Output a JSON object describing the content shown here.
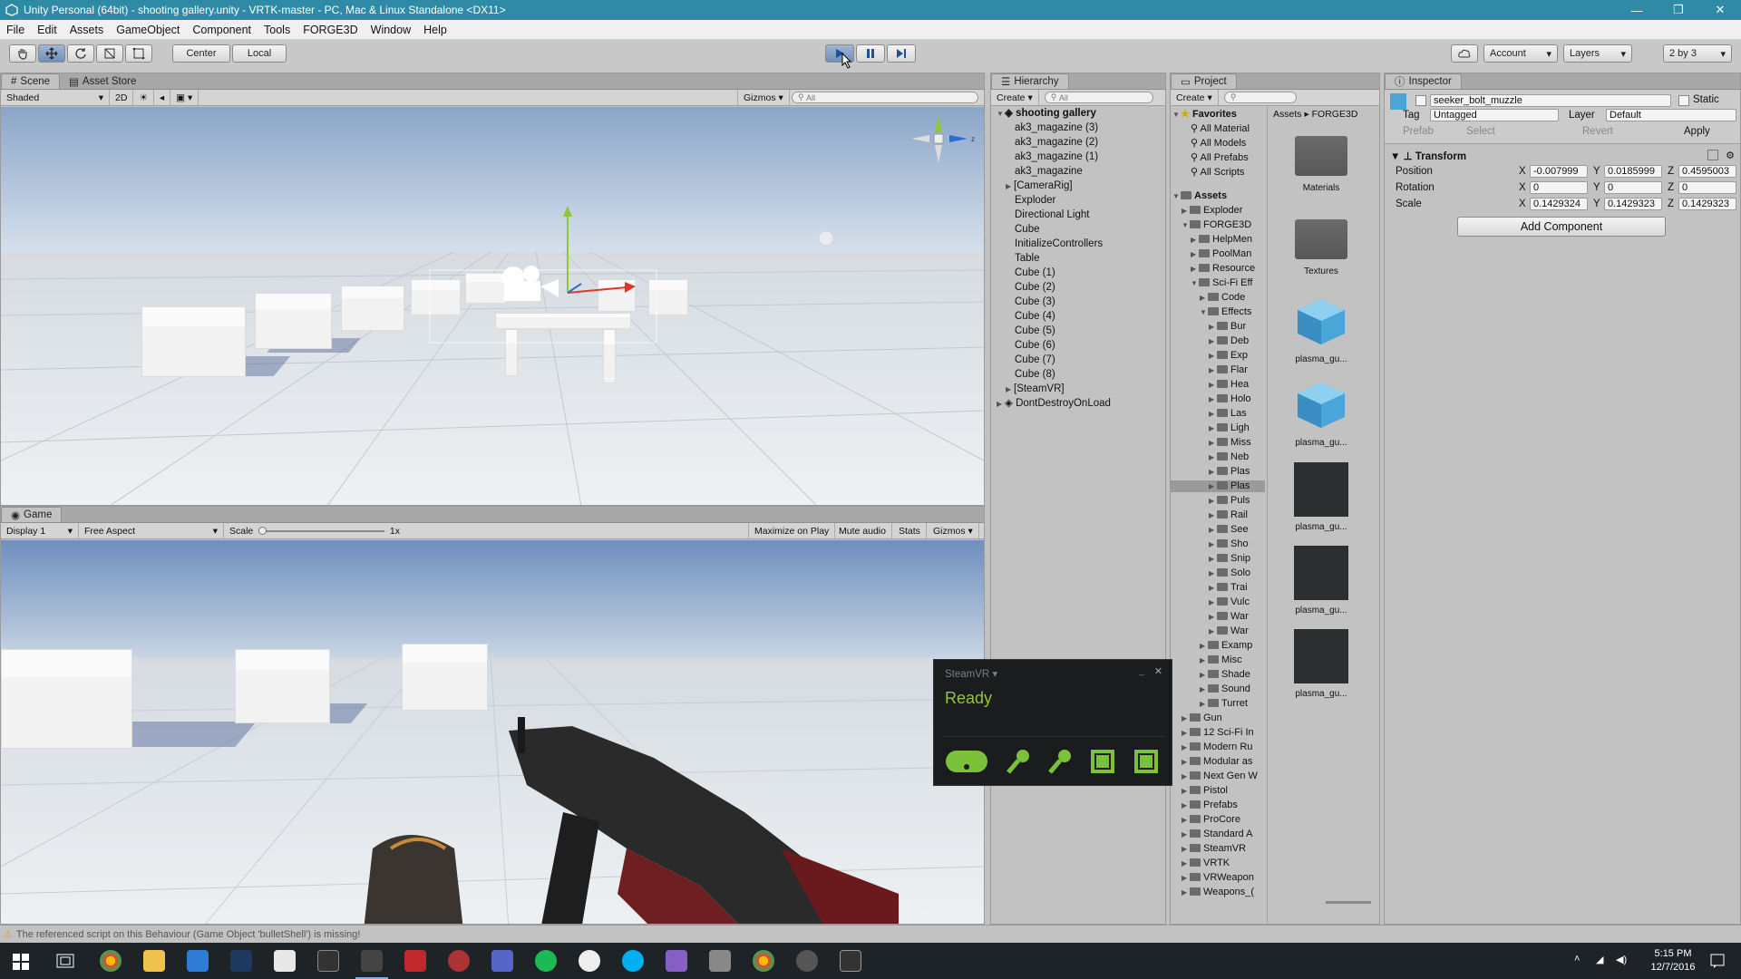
{
  "window": {
    "title": "Unity Personal (64bit) - shooting gallery.unity - VRTK-master - PC, Mac & Linux Standalone <DX11>",
    "controls": [
      "—",
      "❐",
      "✕"
    ]
  },
  "menu": [
    "File",
    "Edit",
    "Assets",
    "GameObject",
    "Component",
    "Tools",
    "FORGE3D",
    "Window",
    "Help"
  ],
  "toolbar": {
    "pivot": "Center",
    "space": "Local",
    "account": "Account",
    "layers": "Layers",
    "layout": "2 by 3"
  },
  "scene": {
    "tabs": [
      "Scene",
      "Asset Store"
    ],
    "shading": "Shaded",
    "mode2d": "2D",
    "gizmos": "Gizmos",
    "search": "All"
  },
  "game": {
    "tab": "Game",
    "display": "Display 1",
    "aspect": "Free Aspect",
    "scale_label": "Scale",
    "scale_value": "1x",
    "maximize": "Maximize on Play",
    "mute": "Mute audio",
    "stats": "Stats",
    "gizmos": "Gizmos"
  },
  "hierarchy": {
    "tab": "Hierarchy",
    "create": "Create",
    "search": "All",
    "scene": "shooting gallery",
    "items": [
      "ak3_magazine (3)",
      "ak3_magazine (2)",
      "ak3_magazine (1)",
      "ak3_magazine",
      "[CameraRig]",
      "Exploder",
      "Directional Light",
      "Cube",
      "InitializeControllers",
      "Table",
      "Cube (1)",
      "Cube (2)",
      "Cube (3)",
      "Cube (4)",
      "Cube (5)",
      "Cube (6)",
      "Cube (7)",
      "Cube (8)",
      "[SteamVR]"
    ],
    "dontdestroy": "DontDestroyOnLoad"
  },
  "project": {
    "tab": "Project",
    "create": "Create",
    "favorites": "Favorites",
    "fav_items": [
      "All Material",
      "All Models",
      "All Prefabs",
      "All Scripts"
    ],
    "assets": "Assets",
    "tree": [
      "Exploder",
      "FORGE3D",
      "HelpMen",
      "PoolMan",
      "Resource",
      "Sci-Fi Eff",
      "Code",
      "Effects",
      "Bur",
      "Deb",
      "Exp",
      "Flar",
      "Hea",
      "Holo",
      "Las",
      "Ligh",
      "Miss",
      "Neb",
      "Plas",
      "Plas",
      "Puls",
      "Rail",
      "See",
      "Sho",
      "Snip",
      "Solo",
      "Trai",
      "Vulc",
      "War",
      "War",
      "Examp",
      "Misc",
      "Shade",
      "Sound",
      "Turret",
      "Gun",
      "12 Sci-Fi In",
      "Modern Ru",
      "Modular as",
      "Next Gen W",
      "Pistol",
      "Prefabs",
      "ProCore",
      "Standard A",
      "SteamVR",
      "VRTK",
      "VRWeapon",
      "Weapons_("
    ],
    "breadcrumb": [
      "Assets",
      "FORGE3D"
    ],
    "grid": [
      "Materials",
      "Textures",
      "plasma_gu...",
      "plasma_gu...",
      "plasma_gu...",
      "plasma_gu...",
      "plasma_gu..."
    ]
  },
  "inspector": {
    "tab": "Inspector",
    "name": "seeker_bolt_muzzle",
    "static": "Static",
    "tag_label": "Tag",
    "tag": "Untagged",
    "layer_label": "Layer",
    "layer": "Default",
    "prefab": "Prefab",
    "select": "Select",
    "revert": "Revert",
    "apply": "Apply",
    "component": "Transform",
    "position_label": "Position",
    "rotation_label": "Rotation",
    "scale_label": "Scale",
    "position": [
      "-0.007999",
      "0.0185999",
      "0.4595003"
    ],
    "rotation": [
      "0",
      "0",
      "0"
    ],
    "scale": [
      "0.1429324",
      "0.1429323",
      "0.1429323"
    ],
    "axes": [
      "X",
      "Y",
      "Z"
    ],
    "add_component": "Add Component"
  },
  "steamvr": {
    "title": "SteamVR ▾",
    "status": "Ready"
  },
  "statusbar": {
    "message": "The referenced script on this Behaviour (Game Object 'bulletShell') is missing!"
  },
  "taskbar": {
    "time": "5:15 PM",
    "date": "12/7/2016"
  }
}
